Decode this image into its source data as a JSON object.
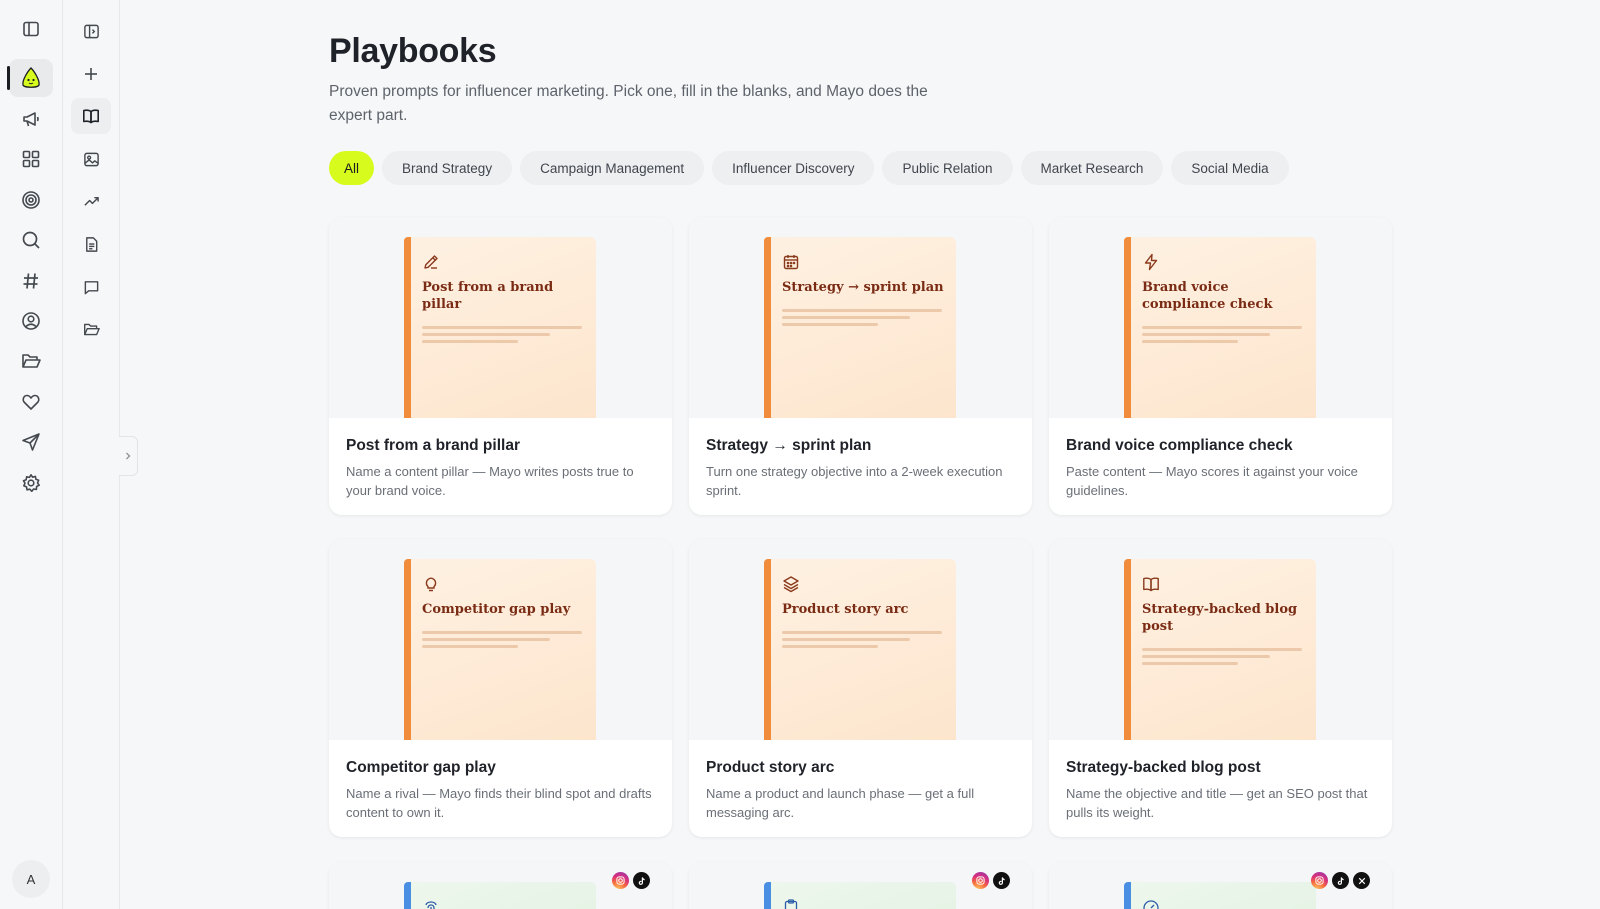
{
  "rail": {
    "items": [
      {
        "icon": "sidebar-toggle-icon"
      },
      {
        "icon": "mayo-logo-icon",
        "active": true
      },
      {
        "icon": "megaphone-icon"
      },
      {
        "icon": "dashboard-icon"
      },
      {
        "icon": "target-icon"
      },
      {
        "icon": "search-icon"
      },
      {
        "icon": "hashtag-icon"
      },
      {
        "icon": "user-circle-icon"
      },
      {
        "icon": "folder-open-icon"
      },
      {
        "icon": "heart-icon"
      },
      {
        "icon": "send-icon"
      },
      {
        "icon": "settings-icon"
      }
    ],
    "avatar_initial": "A"
  },
  "panel": {
    "items": [
      {
        "icon": "panel-expand-icon"
      },
      {
        "icon": "plus-icon"
      },
      {
        "icon": "book-open-icon",
        "active": true
      },
      {
        "icon": "image-icon"
      },
      {
        "icon": "trending-up-icon"
      },
      {
        "icon": "document-icon"
      },
      {
        "icon": "chat-icon"
      },
      {
        "icon": "folder-icon"
      }
    ]
  },
  "main": {
    "title": "Playbooks",
    "subtitle": "Proven prompts for influencer marketing. Pick one, fill in the blanks, and Mayo does the expert part.",
    "filters": [
      "All",
      "Brand Strategy",
      "Campaign Management",
      "Influencer Discovery",
      "Public Relation",
      "Market Research",
      "Social Media"
    ],
    "active_filter": "All",
    "cards": [
      {
        "icon": "pencil-icon",
        "cover_title": "Post from a brand pillar",
        "title": "Post from a brand pillar",
        "description": "Name a content pillar — Mayo writes posts true to your brand voice."
      },
      {
        "icon": "calendar-icon",
        "cover_title": "Strategy → sprint plan",
        "title": "Strategy → sprint plan",
        "description": "Turn one strategy objective into a 2-week execution sprint."
      },
      {
        "icon": "lightning-icon",
        "cover_title": "Brand voice compliance check",
        "title": "Brand voice compliance check",
        "description": "Paste content — Mayo scores it against your voice guidelines."
      },
      {
        "icon": "lightbulb-icon",
        "cover_title": "Competitor gap play",
        "title": "Competitor gap play",
        "description": "Name a rival — Mayo finds their blind spot and drafts content to own it."
      },
      {
        "icon": "layers-icon",
        "cover_title": "Product story arc",
        "title": "Product story arc",
        "description": "Name a product and launch phase — get a full messaging arc."
      },
      {
        "icon": "book-open-icon",
        "cover_title": "Strategy-backed blog post",
        "title": "Strategy-backed blog post",
        "description": "Name the objective and title — get an SEO post that pulls its weight."
      }
    ],
    "partial_cards": [
      {
        "icon": "fingerprint-icon",
        "platforms": [
          "instagram-icon",
          "tiktok-icon"
        ]
      },
      {
        "icon": "clipboard-icon",
        "platforms": [
          "instagram-icon",
          "tiktok-icon"
        ]
      },
      {
        "icon": "gauge-icon",
        "platforms": [
          "instagram-icon",
          "tiktok-icon",
          "x-icon"
        ]
      }
    ]
  },
  "colors": {
    "accent": "#d6fb1c",
    "spine": "#f08c3c",
    "cover_title": "#7a2b14",
    "partial_spine": "#4a8fe3"
  }
}
